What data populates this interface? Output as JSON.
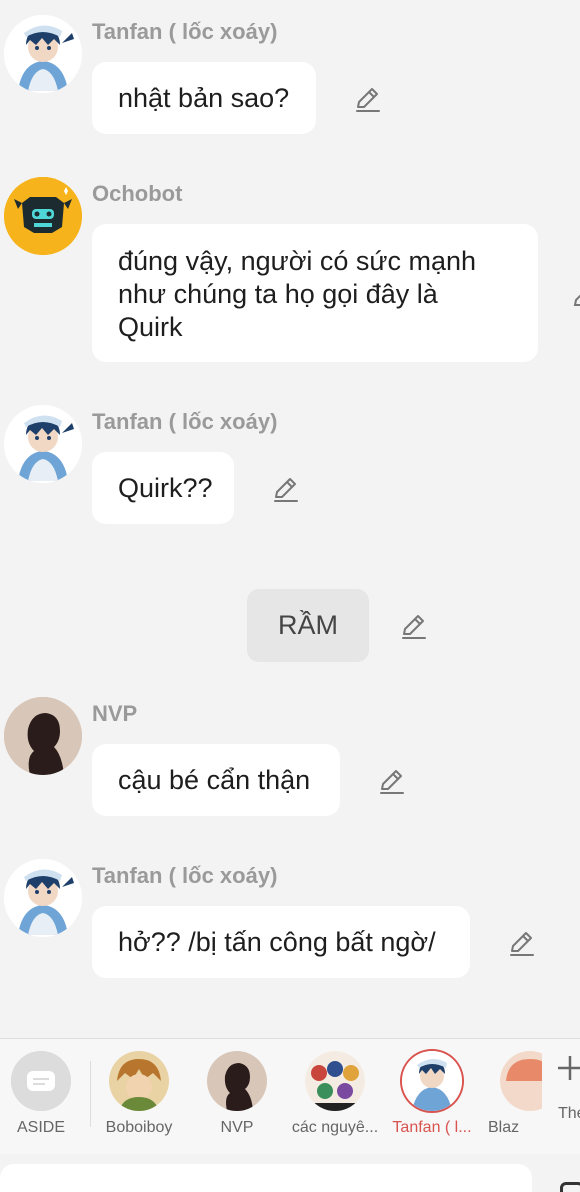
{
  "messages": [
    {
      "sender": "Tanfan ( lốc xoáy)",
      "text": "nhật bản sao?"
    },
    {
      "sender": "Ochobot",
      "lines": [
        "đúng vậy, người có sức mạnh",
        "như chúng ta họ gọi đây là",
        "Quirk"
      ]
    },
    {
      "sender": "Tanfan ( lốc xoáy)",
      "text": "Quirk??"
    },
    {
      "sender": "NVP",
      "text": "cậu bé cẩn thận"
    },
    {
      "sender": "Tanfan ( lốc xoáy)",
      "text": "hở?? /bị tấn công bất ngờ/"
    }
  ],
  "narration": "RẦM",
  "character_bar": {
    "items": [
      {
        "label": "ASIDE",
        "icon": "aside-icon"
      },
      {
        "label": "Boboiboy"
      },
      {
        "label": "NVP"
      },
      {
        "label": "các nguyê..."
      },
      {
        "label": "Tanfan ( l...",
        "active": true
      },
      {
        "label": "Blaz"
      }
    ],
    "more_label": "The"
  },
  "colors": {
    "background": "#f3f3f3",
    "bubble": "#ffffff",
    "sender_name": "#9a9a9a",
    "active_accent": "#d9534f"
  }
}
